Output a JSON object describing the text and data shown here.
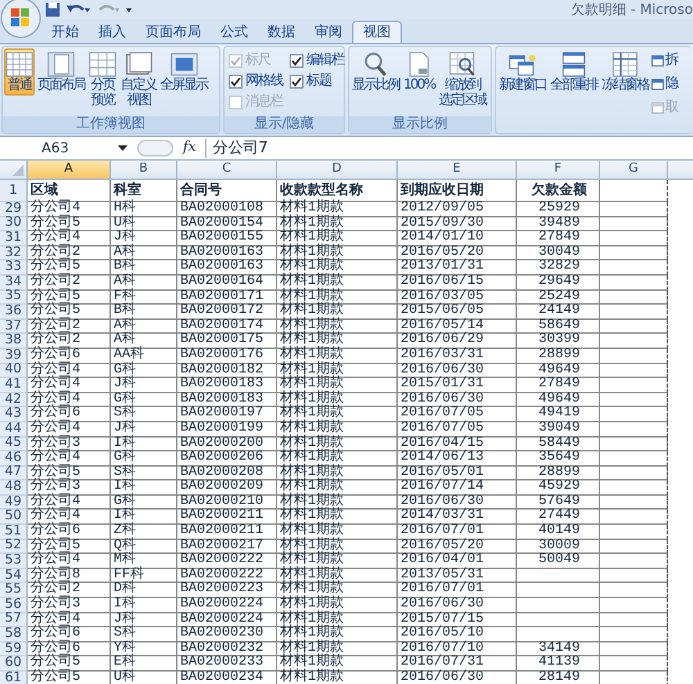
{
  "window": {
    "title": "欠款明细 - Microso"
  },
  "tabs": [
    {
      "label": "开始",
      "selected": false
    },
    {
      "label": "插入",
      "selected": false
    },
    {
      "label": "页面布局",
      "selected": false
    },
    {
      "label": "公式",
      "selected": false
    },
    {
      "label": "数据",
      "selected": false
    },
    {
      "label": "审阅",
      "selected": false
    },
    {
      "label": "视图",
      "selected": true
    }
  ],
  "ribbon": {
    "groups": [
      {
        "label": "工作簿视图",
        "items": [
          {
            "kind": "large",
            "label": "普通",
            "selected": true
          },
          {
            "kind": "large",
            "label": "页面布局",
            "selected": false
          },
          {
            "kind": "large",
            "lines": [
              "分页",
              "预览"
            ],
            "selected": false
          },
          {
            "kind": "large",
            "lines": [
              "自定义",
              "视图"
            ],
            "selected": false
          },
          {
            "kind": "large",
            "label": "全屏显示",
            "selected": false
          }
        ]
      },
      {
        "label": "显示/隐藏",
        "items": [
          {
            "kind": "check",
            "label": "标尺",
            "checked": true,
            "disabled": true
          },
          {
            "kind": "check",
            "label": "编辑栏",
            "checked": true,
            "disabled": false
          },
          {
            "kind": "check",
            "label": "网格线",
            "checked": true,
            "disabled": false
          },
          {
            "kind": "check",
            "label": "标题",
            "checked": true,
            "disabled": false
          },
          {
            "kind": "check",
            "label": "消息栏",
            "checked": false,
            "disabled": true
          }
        ]
      },
      {
        "label": "显示比例",
        "items": [
          {
            "kind": "large",
            "label": "显示比例",
            "selected": false
          },
          {
            "kind": "large",
            "label": "100%",
            "selected": false
          },
          {
            "kind": "large",
            "lines": [
              "缩放到",
              "选定区域"
            ],
            "selected": false
          }
        ]
      },
      {
        "items": [
          {
            "kind": "large",
            "label": "新建窗口",
            "selected": false
          },
          {
            "kind": "large",
            "label": "全部重排",
            "selected": false
          },
          {
            "kind": "large",
            "label": "冻结窗格",
            "selected": false
          },
          {
            "kind": "small",
            "label": "拆",
            "disabled": false
          },
          {
            "kind": "small",
            "label": "隐",
            "disabled": false
          },
          {
            "kind": "small",
            "label": "取",
            "disabled": true
          }
        ]
      }
    ]
  },
  "formula_bar": {
    "name_box": "A63",
    "function_label": "fx",
    "formula": "分公司7"
  },
  "sheet": {
    "columns": [
      {
        "label": "A",
        "selected": true
      },
      {
        "label": "B",
        "selected": false
      },
      {
        "label": "C",
        "selected": false
      },
      {
        "label": "D",
        "selected": false
      },
      {
        "label": "E",
        "selected": false
      },
      {
        "label": "F",
        "selected": false
      },
      {
        "label": "G",
        "selected": false
      }
    ],
    "header_row": {
      "number": "1",
      "cells": [
        "区域",
        "科室",
        "合同号",
        "收款款型名称",
        "到期应收日期",
        "欠款金额"
      ]
    },
    "rows": [
      {
        "number": "29",
        "cells": [
          "分公司4",
          "H科",
          "BA02000108",
          "材料1期款",
          "2012/09/05",
          "25929"
        ]
      },
      {
        "number": "30",
        "cells": [
          "分公司5",
          "U科",
          "BA02000154",
          "材料1期款",
          "2015/09/30",
          "39489"
        ]
      },
      {
        "number": "31",
        "cells": [
          "分公司4",
          "J科",
          "BA02000155",
          "材料1期款",
          "2014/01/10",
          "27849"
        ]
      },
      {
        "number": "32",
        "cells": [
          "分公司2",
          "A科",
          "BA02000163",
          "材料1期款",
          "2016/05/20",
          "30049"
        ]
      },
      {
        "number": "33",
        "cells": [
          "分公司5",
          "B科",
          "BA02000163",
          "材料1期款",
          "2013/01/31",
          "32829"
        ]
      },
      {
        "number": "34",
        "cells": [
          "分公司2",
          "A科",
          "BA02000164",
          "材料1期款",
          "2016/06/15",
          "29649"
        ]
      },
      {
        "number": "35",
        "cells": [
          "分公司5",
          "F科",
          "BA02000171",
          "材料1期款",
          "2016/03/05",
          "25249"
        ]
      },
      {
        "number": "36",
        "cells": [
          "分公司5",
          "B科",
          "BA02000172",
          "材料1期款",
          "2015/06/05",
          "24149"
        ]
      },
      {
        "number": "37",
        "cells": [
          "分公司2",
          "A科",
          "BA02000174",
          "材料1期款",
          "2016/05/14",
          "58649"
        ]
      },
      {
        "number": "38",
        "cells": [
          "分公司2",
          "A科",
          "BA02000175",
          "材料1期款",
          "2016/06/29",
          "30399"
        ]
      },
      {
        "number": "39",
        "cells": [
          "分公司6",
          "AA科",
          "BA02000176",
          "材料1期款",
          "2016/03/31",
          "28899"
        ]
      },
      {
        "number": "40",
        "cells": [
          "分公司4",
          "G科",
          "BA02000182",
          "材料1期款",
          "2016/06/30",
          "49649"
        ]
      },
      {
        "number": "41",
        "cells": [
          "分公司4",
          "J科",
          "BA02000183",
          "材料1期款",
          "2015/01/31",
          "27849"
        ]
      },
      {
        "number": "42",
        "cells": [
          "分公司4",
          "G科",
          "BA02000183",
          "材料1期款",
          "2016/06/30",
          "49649"
        ]
      },
      {
        "number": "43",
        "cells": [
          "分公司6",
          "S科",
          "BA02000197",
          "材料1期款",
          "2016/07/05",
          "49419"
        ]
      },
      {
        "number": "44",
        "cells": [
          "分公司4",
          "J科",
          "BA02000199",
          "材料1期款",
          "2016/07/05",
          "39049"
        ]
      },
      {
        "number": "45",
        "cells": [
          "分公司3",
          "I科",
          "BA02000200",
          "材料1期款",
          "2016/04/15",
          "58449"
        ]
      },
      {
        "number": "46",
        "cells": [
          "分公司4",
          "G科",
          "BA02000206",
          "材料1期款",
          "2014/06/13",
          "35649"
        ]
      },
      {
        "number": "47",
        "cells": [
          "分公司5",
          "S科",
          "BA02000208",
          "材料1期款",
          "2016/05/01",
          "28899"
        ]
      },
      {
        "number": "48",
        "cells": [
          "分公司3",
          "I科",
          "BA02000209",
          "材料1期款",
          "2016/07/14",
          "45929"
        ]
      },
      {
        "number": "49",
        "cells": [
          "分公司4",
          "G科",
          "BA02000210",
          "材料1期款",
          "2016/06/30",
          "57649"
        ]
      },
      {
        "number": "50",
        "cells": [
          "分公司4",
          "I科",
          "BA02000211",
          "材料1期款",
          "2014/03/31",
          "27449"
        ]
      },
      {
        "number": "51",
        "cells": [
          "分公司6",
          "Z科",
          "BA02000211",
          "材料1期款",
          "2016/07/01",
          "40149"
        ]
      },
      {
        "number": "52",
        "cells": [
          "分公司5",
          "Q科",
          "BA02000217",
          "材料1期款",
          "2016/05/20",
          "30009"
        ]
      },
      {
        "number": "53",
        "cells": [
          "分公司4",
          "M科",
          "BA02000222",
          "材料1期款",
          "2016/04/01",
          "50049"
        ]
      },
      {
        "number": "54",
        "cells": [
          "分公司8",
          "FF科",
          "BA02000222",
          "材料1期款",
          "2013/05/31"
        ]
      },
      {
        "number": "55",
        "cells": [
          "分公司2",
          "D科",
          "BA02000223",
          "材料1期款",
          "2016/07/01"
        ]
      },
      {
        "number": "56",
        "cells": [
          "分公司3",
          "I科",
          "BA02000224",
          "材料1期款",
          "2016/06/30"
        ]
      },
      {
        "number": "57",
        "cells": [
          "分公司4",
          "J科",
          "BA02000224",
          "材料1期款",
          "2015/07/15"
        ]
      },
      {
        "number": "58",
        "cells": [
          "分公司6",
          "S科",
          "BA02000230",
          "材料1期款",
          "2016/05/10"
        ]
      },
      {
        "number": "59",
        "cells": [
          "分公司6",
          "Y科",
          "BA02000232",
          "材料1期款",
          "2016/07/10",
          "34149"
        ]
      },
      {
        "number": "60",
        "cells": [
          "分公司5",
          "E科",
          "BA02000233",
          "材料1期款",
          "2016/07/31",
          "41139"
        ]
      },
      {
        "number": "61",
        "cells": [
          "分公司5",
          "U科",
          "BA02000234",
          "材料1期款",
          "2016/06/30",
          "28149"
        ]
      }
    ]
  }
}
